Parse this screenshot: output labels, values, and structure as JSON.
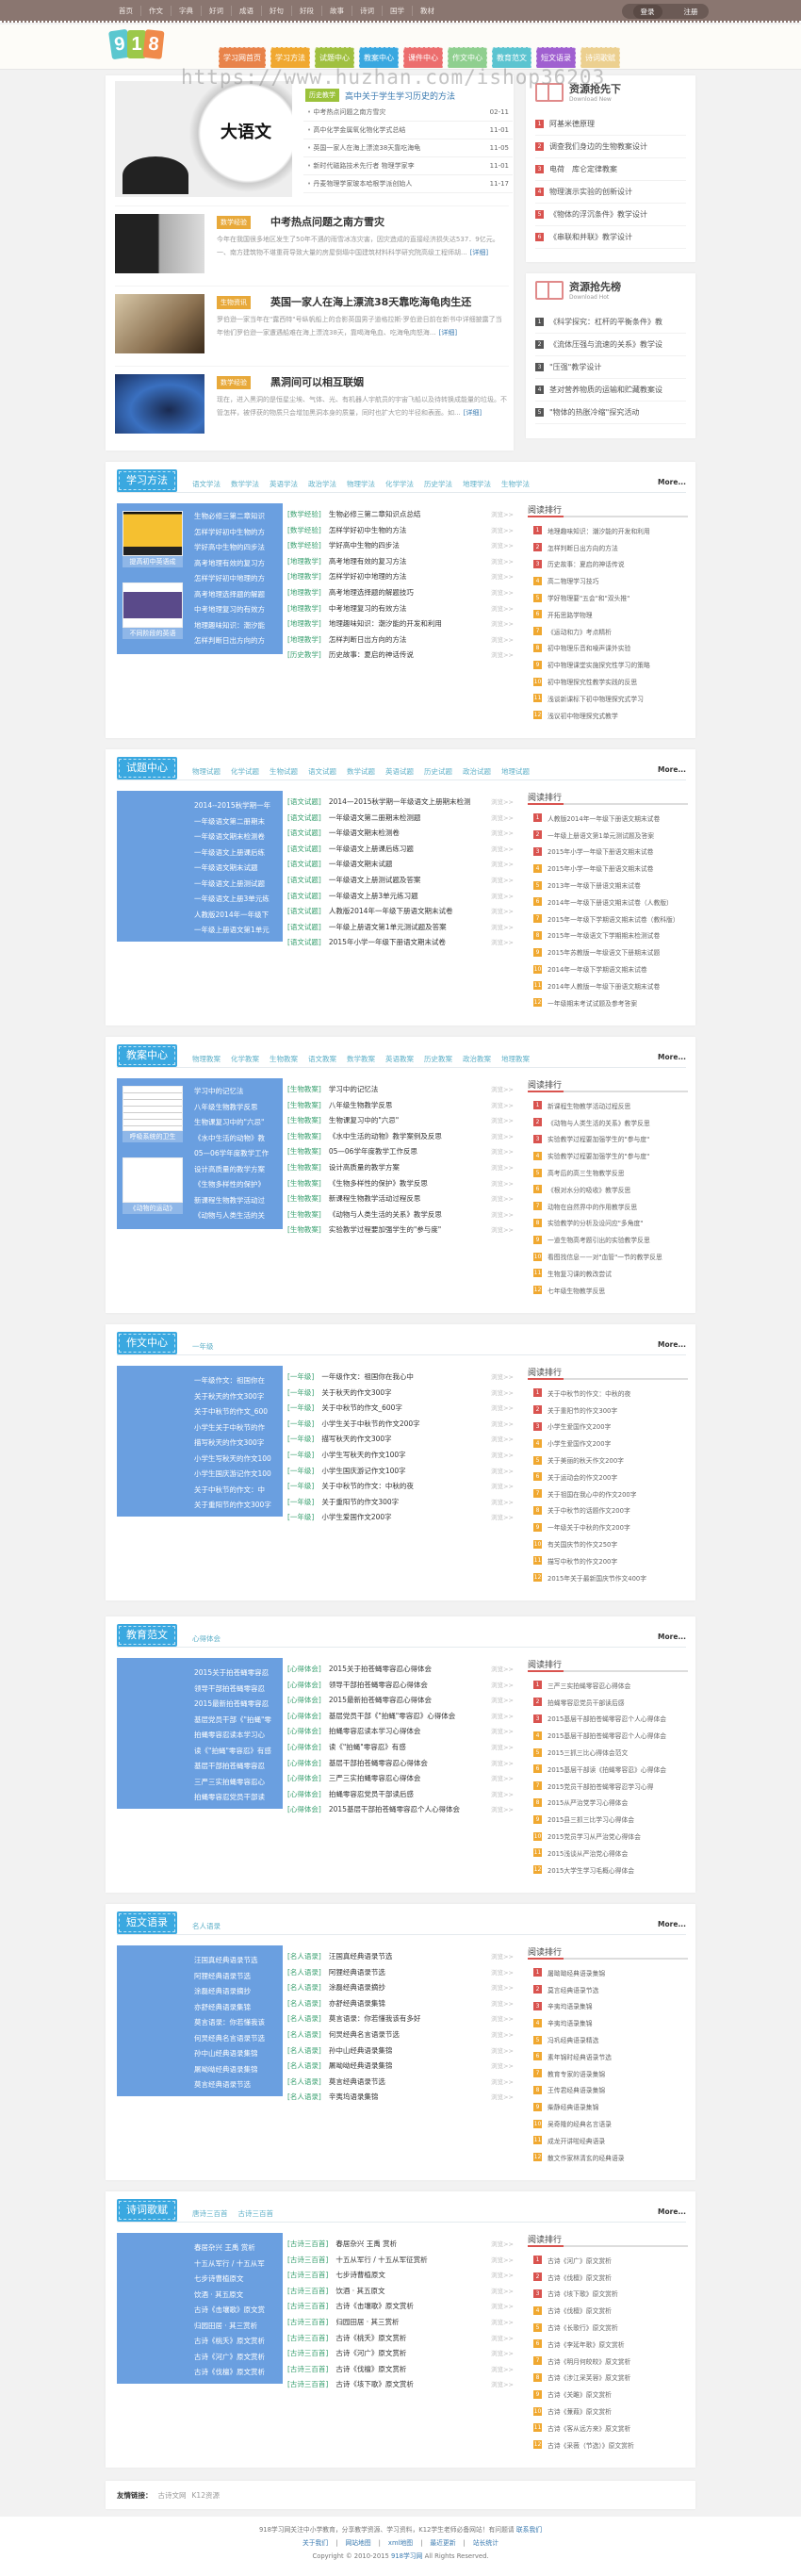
{
  "topnav": [
    "首页",
    "作文",
    "字典",
    "好词",
    "成语",
    "好句",
    "好段",
    "故事",
    "诗词",
    "国学",
    "教材"
  ],
  "auth": {
    "login": "登录",
    "register": "注册"
  },
  "logo": {
    "digits": [
      "9",
      "1",
      "8"
    ],
    "colors": [
      "#5bc7cf",
      "#9cc84a",
      "#f08a4a"
    ]
  },
  "tabs": [
    {
      "label": "学习网首页",
      "color": "#e8834a"
    },
    {
      "label": "学习方法",
      "color": "#f0a830"
    },
    {
      "label": "试题中心",
      "color": "#a0c040"
    },
    {
      "label": "教案中心",
      "color": "#3aa8e0"
    },
    {
      "label": "课件中心",
      "color": "#ec6e6e"
    },
    {
      "label": "作文中心",
      "color": "#8fcf8f"
    },
    {
      "label": "教育范文",
      "color": "#5cc4d0"
    },
    {
      "label": "短文语录",
      "color": "#a060d0"
    },
    {
      "label": "诗词歌赋",
      "color": "#ecd090"
    }
  ],
  "watermark": "https://www.huzhan.com/ishop36203",
  "hero": {
    "image_text": "大语文",
    "headline_tag": "历史教学",
    "headline": "高中关于学生学习历史的方法",
    "news": [
      {
        "title": "中考热点问题之南方雪灾",
        "date": "02-11"
      },
      {
        "title": "高中化学金属氧化物化学式总结",
        "date": "11-01"
      },
      {
        "title": "英国一家人在海上漂流38天靠吃海龟",
        "date": "11-05"
      },
      {
        "title": "新时代磁路技术先行者 物理学家李",
        "date": "11-01"
      },
      {
        "title": "丹麦物理学家玻本哈根学派创始人",
        "date": "11-17"
      }
    ],
    "articles": [
      {
        "tag": "数学经验",
        "title": "中考热点问题之南方雪灾",
        "summary": "今年在我国很多地区发生了50年不遇的雨雪冰冻灾害，因灾造成的直接经济损失达537．9亿元。一、南方建筑物不堪重荷导致大量的房屋倒塌中国建筑材料科学研究院高级工程师胡...",
        "more": "[详细]"
      },
      {
        "tag": "生物资讯",
        "title": "英国一家人在海上漂流38天靠吃海龟肉生还",
        "summary": "罗伯逊一家当年在\"露西特\"号纵帆船上的合影英国男子道格拉斯·罗伯逊日前在新书中详细披露了当年他们罗伯逊一家遭遇船难在海上漂流38天，靠喝海龟血、吃海龟肉怒海...",
        "more": "[详细]"
      },
      {
        "tag": "数学经验",
        "title": "黑洞间可以相互联姻",
        "summary": "现在，进入黑洞的是恒星尘埃、气体、光、有机器人宇航员的宇宙飞船以及待转换成能量的垃圾。不管怎样，被俘获的物质只会增加黑洞本身的质量，同时也扩大它的半径和表面。如...",
        "more": "[详细]"
      }
    ]
  },
  "sidebar": [
    {
      "title": "资源抢先下",
      "subtitle": "Download New",
      "badge_color": "#d9534f",
      "items": [
        "阿基米德原理",
        "调查我们身边的生物教案设计",
        "电荷　库仑定律教案",
        "物理演示实验的创新设计",
        "《物体的浮沉条件》教学设计",
        "《串联和并联》教学设计"
      ]
    },
    {
      "title": "资源抢先榜",
      "subtitle": "Download Hot",
      "badge_color": "#555555",
      "items": [
        "《科学探究：杠杆的平衡条件》教",
        "《流体压强与流速的关系》教学设",
        "\"压强\"教学设计",
        "茎对营养物质的运输和贮藏教案设",
        "\"物体的热胀冷缩\"探究活动"
      ]
    }
  ],
  "common": {
    "more": "More...",
    "view": "浏览>>",
    "rank_title": "阅读排行",
    "rank_colors": {
      "top": "#d9534f",
      "rest": "#f0a830"
    }
  },
  "sections": [
    {
      "title": "学习方法",
      "subs": [
        "语文学法",
        "数学学法",
        "英语学法",
        "政治学法",
        "物理学法",
        "化学学法",
        "历史学法",
        "地理学法",
        "生物学法"
      ],
      "pics": [
        "提高初中英语成",
        "不同阶段的英语"
      ],
      "left": [
        "生物必修三第二章知识",
        "怎样学好初中生物的方",
        "学好高中生物的四步法",
        "高考地理有效的复习方",
        "怎样学好初中地理的方",
        "高考地理选择题的解题",
        "中考地理复习的有效方",
        "地理趣味知识：潮汐能",
        "怎样判断日出方向的方"
      ],
      "list": [
        {
          "t": "[数学经验]",
          "x": "生物必修三第二章知识点总结"
        },
        {
          "t": "[数学经验]",
          "x": "怎样学好初中生物的方法"
        },
        {
          "t": "[数学经验]",
          "x": "学好高中生物的四步法"
        },
        {
          "t": "[地理教学]",
          "x": "高考地理有效的复习方法"
        },
        {
          "t": "[地理教学]",
          "x": "怎样学好初中地理的方法"
        },
        {
          "t": "[地理教学]",
          "x": "高考地理选择题的解题技巧"
        },
        {
          "t": "[地理教学]",
          "x": "中考地理复习的有效方法"
        },
        {
          "t": "[地理教学]",
          "x": "地理趣味知识：潮汐能的开发和利用"
        },
        {
          "t": "[地理教学]",
          "x": "怎样判断日出方向的方法"
        },
        {
          "t": "[历史教学]",
          "x": "历史故事：夏启的神话传说"
        }
      ],
      "rank": [
        "地理趣味知识：潮汐能的开发和利用",
        "怎样判断日出方向的方法",
        "历史故事：夏启的神话传说",
        "高二物理学习技巧",
        "学好物理要\"五会\"和\"双头推\"",
        "开拓思路学物理",
        "《运动和力》考点精析",
        "初中物理乐音和噪声课外实验",
        "初中物理课堂实施探究性学习的策略",
        "初中物理探究性教学实践的反思",
        "浅谈新课标下初中物理探究式学习",
        "浅议初中物理探究式教学"
      ]
    },
    {
      "title": "试题中心",
      "subs": [
        "物理试题",
        "化学试题",
        "生物试题",
        "语文试题",
        "数学试题",
        "英语试题",
        "历史试题",
        "政治试题",
        "地理试题"
      ],
      "pics": [],
      "left": [
        "2014--2015秋学期一年",
        "一年级语文第二册期末",
        "一年级语文期末检测卷",
        "一年级语文上册课后练",
        "一年级语文期末试题",
        "一年级语文上册测试题",
        "一年级语文上册3单元练",
        "人教版2014年一年级下",
        "一年级上册语文第1单元"
      ],
      "list": [
        {
          "t": "[语文试题]",
          "x": "2014—2015秋学期一年级语文上册期末检测"
        },
        {
          "t": "[语文试题]",
          "x": "一年级语文第二册期末检测题"
        },
        {
          "t": "[语文试题]",
          "x": "一年级语文期末检测卷"
        },
        {
          "t": "[语文试题]",
          "x": "一年级语文上册课后练习题"
        },
        {
          "t": "[语文试题]",
          "x": "一年级语文期末试题"
        },
        {
          "t": "[语文试题]",
          "x": "一年级语文上册测试题及答案"
        },
        {
          "t": "[语文试题]",
          "x": "一年级语文上册3单元练习题"
        },
        {
          "t": "[语文试题]",
          "x": "人教版2014年一年级下册语文期末试卷"
        },
        {
          "t": "[语文试题]",
          "x": "一年级上册语文第1单元测试题及答案"
        },
        {
          "t": "[语文试题]",
          "x": "2015年小学一年级下册语文期末试卷"
        }
      ],
      "rank": [
        "人教版2014年一年级下册语文期末试卷",
        "一年级上册语文第1单元测试题及答案",
        "2015年小学一年级下册语文期末试卷",
        "2015年小学一年级下册语文期末试卷",
        "2013年一年级下册语文期末试卷",
        "2014年一年级下册语文期末试卷（人教版）",
        "2015年一年级下学期语文期末试卷（教科版）",
        "2015年一年级语文下学期期末检测试卷",
        "2015年苏教版一年级语文下册期末试题",
        "2014年一年级下学期语文期末试卷",
        "2014年人教版一年级下册语文期末试卷",
        "一年级期末考试试题及参考答案"
      ]
    },
    {
      "title": "教案中心",
      "subs": [
        "物理教案",
        "化学教案",
        "生物教案",
        "语文教案",
        "数学教案",
        "英语教案",
        "历史教案",
        "政治教案",
        "地理教案"
      ],
      "pics": [
        "呼吸系统的卫生",
        "《动物的运动》"
      ],
      "left": [
        "学习中的记忆法",
        "八年级生物教学反思",
        "生物课复习中的\"六忌\"",
        "《水中生活的动物》教",
        "05—06学年度教学工作",
        "设计高质量的教学方案",
        "《生物多样性的保护》",
        "新课程生物教学活动过",
        "《动物与人类生活的关"
      ],
      "list": [
        {
          "t": "[生物教案]",
          "x": "学习中的记忆法"
        },
        {
          "t": "[生物教案]",
          "x": "八年级生物教学反思"
        },
        {
          "t": "[生物教案]",
          "x": "生物课复习中的\"六忌\""
        },
        {
          "t": "[生物教案]",
          "x": "《水中生活的动物》教学案例及反思"
        },
        {
          "t": "[生物教案]",
          "x": "05—06学年度教学工作反思"
        },
        {
          "t": "[生物教案]",
          "x": "设计高质量的教学方案"
        },
        {
          "t": "[生物教案]",
          "x": "《生物多样性的保护》教学反思"
        },
        {
          "t": "[生物教案]",
          "x": "新课程生物教学活动过程反思"
        },
        {
          "t": "[生物教案]",
          "x": "《动物与人类生活的关系》教学反思"
        },
        {
          "t": "[生物教案]",
          "x": "实验教学过程要加强学生的\"参与度\""
        }
      ],
      "rank": [
        "新课程生物教学活动过程反思",
        "《动物与人类生活的关系》教学反思",
        "实验教学过程要加强学生的\"参与度\"",
        "实验教学过程要加强学生的\"参与度\"",
        "高考后的高三生物教学反思",
        "《根对水分的吸收》教学反思",
        "动物在自然界中的作用教学反思",
        "实验教学的分析及设问应\"多角度\"",
        "一道生物高考题引出的实验教学反思",
        "看图找信息——对\"血管\"一节的教学反思",
        "生物复习课的教改尝试",
        "七年级生物教学反思"
      ]
    },
    {
      "title": "作文中心",
      "subs": [
        "一年级"
      ],
      "pics": [],
      "left": [
        "一年级作文：祖国你在",
        "关于秋天的作文300字",
        "关于中秋节的作文_600",
        "小学生关于中秋节的作",
        "描写秋天的作文300字",
        "小学生写秋天的作文100",
        "小学生国庆游记作文100",
        "关于中秋节的作文：中",
        "关于重阳节的作文300字"
      ],
      "list": [
        {
          "t": "[一年级]",
          "x": "一年级作文：祖国你在我心中"
        },
        {
          "t": "[一年级]",
          "x": "关于秋天的作文300字"
        },
        {
          "t": "[一年级]",
          "x": "关于中秋节的作文_600字"
        },
        {
          "t": "[一年级]",
          "x": "小学生关于中秋节的作文200字"
        },
        {
          "t": "[一年级]",
          "x": "描写秋天的作文300字"
        },
        {
          "t": "[一年级]",
          "x": "小学生写秋天的作文100字"
        },
        {
          "t": "[一年级]",
          "x": "小学生国庆游记作文100字"
        },
        {
          "t": "[一年级]",
          "x": "关于中秋节的作文：中秋的夜"
        },
        {
          "t": "[一年级]",
          "x": "关于重阳节的作文300字"
        },
        {
          "t": "[一年级]",
          "x": "小学生爱国作文200字"
        }
      ],
      "rank": [
        "关于中秋节的作文：中秋的夜",
        "关于重阳节的作文300字",
        "小学生爱国作文200字",
        "小学生爱国作文200字",
        "关于美丽的秋天作文200字",
        "关于运动会的作文200字",
        "关于祖国在我心中的作文200字",
        "关于中秋节的话题作文200字",
        "一年级关于中秋的作文200字",
        "有关国庆节的作文250字",
        "描写中秋节的作文200字",
        "2015年关于最新国庆节作文400字"
      ]
    },
    {
      "title": "教育范文",
      "subs": [
        "心得体会"
      ],
      "pics": [],
      "left": [
        "2015关于拍苍蝇零容忍",
        "领导干部拍苍蝇零容忍",
        "2015最新拍苍蝇零容忍",
        "基层党员干部《\"拍蝇\"零",
        "拍蝇零容忍读本学习心",
        "读《\"拍蝇\"零容忍》有感",
        "基层干部拍苍蝇零容忍",
        "三严三实拍蝇零容忍心",
        "拍蝇零容忍党员干部读"
      ],
      "list": [
        {
          "t": "[心得体会]",
          "x": "2015关于拍苍蝇零容忍心得体会"
        },
        {
          "t": "[心得体会]",
          "x": "领导干部拍苍蝇零容忍心得体会"
        },
        {
          "t": "[心得体会]",
          "x": "2015最新拍苍蝇零容忍心得体会"
        },
        {
          "t": "[心得体会]",
          "x": "基层党员干部《\"拍蝇\"零容忍》心得体会"
        },
        {
          "t": "[心得体会]",
          "x": "拍蝇零容忍读本学习心得体会"
        },
        {
          "t": "[心得体会]",
          "x": "读《\"拍蝇\"零容忍》有感"
        },
        {
          "t": "[心得体会]",
          "x": "基层干部拍苍蝇零容忍心得体会"
        },
        {
          "t": "[心得体会]",
          "x": "三严三实拍蝇零容忍心得体会"
        },
        {
          "t": "[心得体会]",
          "x": "拍蝇零容忍党员干部读后感"
        },
        {
          "t": "[心得体会]",
          "x": "2015基层干部拍苍蝇零容忍个人心得体会"
        }
      ],
      "rank": [
        "三严三实拍蝇零容忍心得体会",
        "拍蝇零容忍党员干部读后感",
        "2015基层干部拍苍蝇零容忍个人心得体会",
        "2015基层干部拍苍蝇零容忍个人心得体会",
        "2015三抓三比心得体会范文",
        "2015基层干部读《拍蝇零容忍》心得体会",
        "2015党员干部拍苍蝇零容忍学习心得",
        "2015从严治党学习心得体会",
        "2015县三抓三比学习心得体会",
        "2015党员学习从严治党心得体会",
        "2015浅谈从严治党心得体会",
        "2015大学生学习毛概心得体会"
      ]
    },
    {
      "title": "短文语录",
      "subs": [
        "名人语录"
      ],
      "pics": [],
      "left": [
        "汪国真经典语录节选",
        "阿狸经典语录节选",
        "涂磊经典语录摘抄",
        "亦舒经典语录集锦",
        "莫言语录：你若懂我该",
        "何炅经典名言语录节选",
        "孙中山经典语录集锦",
        "屠呦呦经典语录集锦",
        "莫言经典语录节选"
      ],
      "list": [
        {
          "t": "[名人语录]",
          "x": "汪国真经典语录节选"
        },
        {
          "t": "[名人语录]",
          "x": "阿狸经典语录节选"
        },
        {
          "t": "[名人语录]",
          "x": "涂磊经典语录摘抄"
        },
        {
          "t": "[名人语录]",
          "x": "亦舒经典语录集锦"
        },
        {
          "t": "[名人语录]",
          "x": "莫言语录：你若懂我该有多好"
        },
        {
          "t": "[名人语录]",
          "x": "何炅经典名言语录节选"
        },
        {
          "t": "[名人语录]",
          "x": "孙中山经典语录集锦"
        },
        {
          "t": "[名人语录]",
          "x": "屠呦呦经典语录集锦"
        },
        {
          "t": "[名人语录]",
          "x": "莫言经典语录节选"
        },
        {
          "t": "[名人语录]",
          "x": "辛夷坞语录集锦"
        }
      ],
      "rank": [
        "屠呦呦经典语录集锦",
        "莫言经典语录节选",
        "辛夷坞语录集锦",
        "辛夷坞语录集锦",
        "冯巩经典语录精选",
        "素年锦时经典语录节选",
        "教育专家的语录集锦",
        "王传君经典语录集锦",
        "柴静经典语录集锦",
        "吴奇隆的经典名言语录",
        "成龙开讲啦经典语录",
        "散文作家林清玄的经典语录"
      ]
    },
    {
      "title": "诗词歌赋",
      "subs": [
        "唐诗三百首",
        "古诗三百首"
      ],
      "pics": [],
      "left": [
        "春居杂兴 王禹 赏析",
        "十五从军行 / 十五从军",
        "七步诗曹植原文",
        "饮酒 · 其五原文",
        "古诗《击壤歌》原文赏",
        "归园田居 · 其三赏析",
        "古诗《桃夭》原文赏析",
        "古诗《河广》原文赏析",
        "古诗《伐檀》原文赏析"
      ],
      "list": [
        {
          "t": "[古诗三百首]",
          "x": "春居杂兴 王禹 赏析"
        },
        {
          "t": "[古诗三百首]",
          "x": "十五从军行 / 十五从军征赏析"
        },
        {
          "t": "[古诗三百首]",
          "x": "七步诗曹植原文"
        },
        {
          "t": "[古诗三百首]",
          "x": "饮酒 · 其五原文"
        },
        {
          "t": "[古诗三百首]",
          "x": "古诗《击壤歌》原文赏析"
        },
        {
          "t": "[古诗三百首]",
          "x": "归园田居 · 其三赏析"
        },
        {
          "t": "[古诗三百首]",
          "x": "古诗《桃夭》原文赏析"
        },
        {
          "t": "[古诗三百首]",
          "x": "古诗《河广》原文赏析"
        },
        {
          "t": "[古诗三百首]",
          "x": "古诗《伐檀》原文赏析"
        },
        {
          "t": "[古诗三百首]",
          "x": "古诗《垓下歌》原文赏析"
        }
      ],
      "rank": [
        "古诗《河广》原文赏析",
        "古诗《伐檀》原文赏析",
        "古诗《垓下歌》原文赏析",
        "古诗《伐檀》原文赏析",
        "古诗《长歌行》原文赏析",
        "古诗《李延年歌》原文赏析",
        "古诗《明月何皎皎》原文赏析",
        "古诗《涉江采芙蓉》原文赏析",
        "古诗《关雎》原文赏析",
        "古诗《蒹葭》原文赏析",
        "古诗《客从远方来》原文赏析",
        "古诗《采薇（节选）》原文赏析"
      ]
    }
  ],
  "friend_links": {
    "label": "友情链接：",
    "links": [
      "古诗文网",
      "K12资源"
    ]
  },
  "footer": {
    "line1": "918学习网关注中小学教育，分享教学资源、学习资料，K12学生老师必备网站！有问题请",
    "contact": "联系我们",
    "links": [
      "关于我们",
      "网站地图",
      "xml地图",
      "最近更新",
      "站长统计"
    ],
    "sep": "|",
    "copy1": "Copyright © 2010-2015",
    "brand": "918学习网",
    "copy2": "All Rights Reserved."
  }
}
